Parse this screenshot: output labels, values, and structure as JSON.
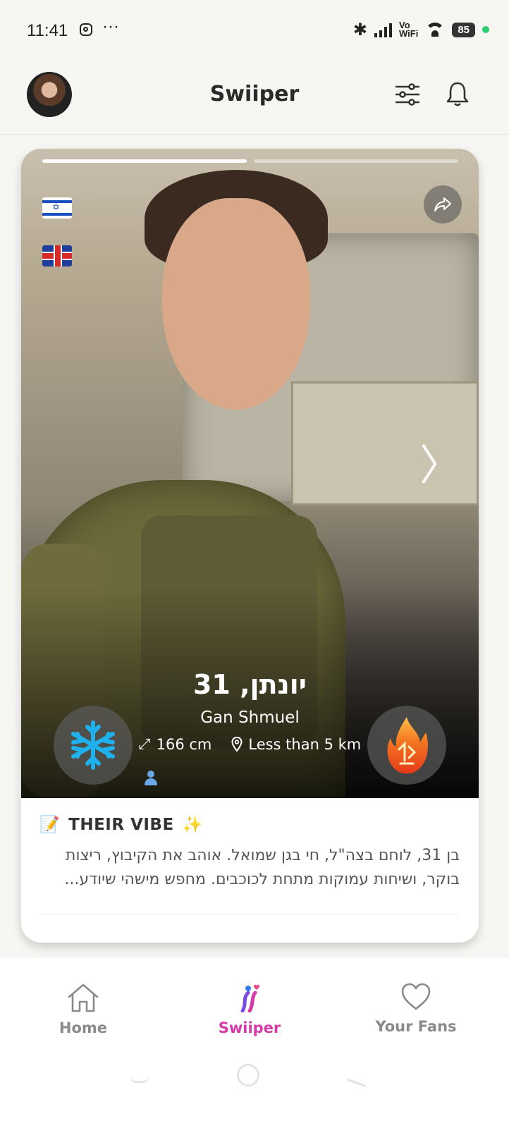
{
  "status_bar": {
    "time": "11:41",
    "more_indicator": "···",
    "vowifi_line1": "Vo",
    "vowifi_line2": "WiFi",
    "battery": "85",
    "icons": [
      "instagram-icon",
      "bluetooth-icon",
      "signal-icon",
      "wifi-icon",
      "battery-icon"
    ]
  },
  "header": {
    "title": "Swiiper",
    "icons": [
      "avatar",
      "filter-sliders-icon",
      "bell-icon"
    ]
  },
  "profile": {
    "name_age": "יונתן, 31",
    "city": "Gan Shmuel",
    "height": "166 cm",
    "distance": "Less than 5 km",
    "languages": [
      "israel-flag-icon",
      "uk-flag-icon"
    ],
    "photo_progress": {
      "total_segments": 2,
      "active_segment": 1
    },
    "actions": [
      "freeze-snowflake-icon",
      "fire-icon"
    ]
  },
  "vibe": {
    "emoji": "📝",
    "title": "THEIR VIBE",
    "sparkle": "✨",
    "text": "בן 31, לוחם בצה\"ל, חי בגן שמואל. אוהב את הקיבוץ, ריצות בוקר, ושיחות עמוקות מתחת לכוכבים. מחפש מישהי שיודע..."
  },
  "bottom_nav": {
    "items": [
      {
        "label": "Home",
        "icon": "home-icon",
        "active": false
      },
      {
        "label": "Swiiper",
        "icon": "swiiper-logo-icon",
        "active": true
      },
      {
        "label": "Your Fans",
        "icon": "heart-icon",
        "active": false
      }
    ]
  },
  "colors": {
    "accent": "#d63aa7",
    "inactive": "#8a8a8a",
    "background": "#f6f6f3",
    "freeze": "#1fb0ee",
    "fire": "#f26a1b"
  }
}
